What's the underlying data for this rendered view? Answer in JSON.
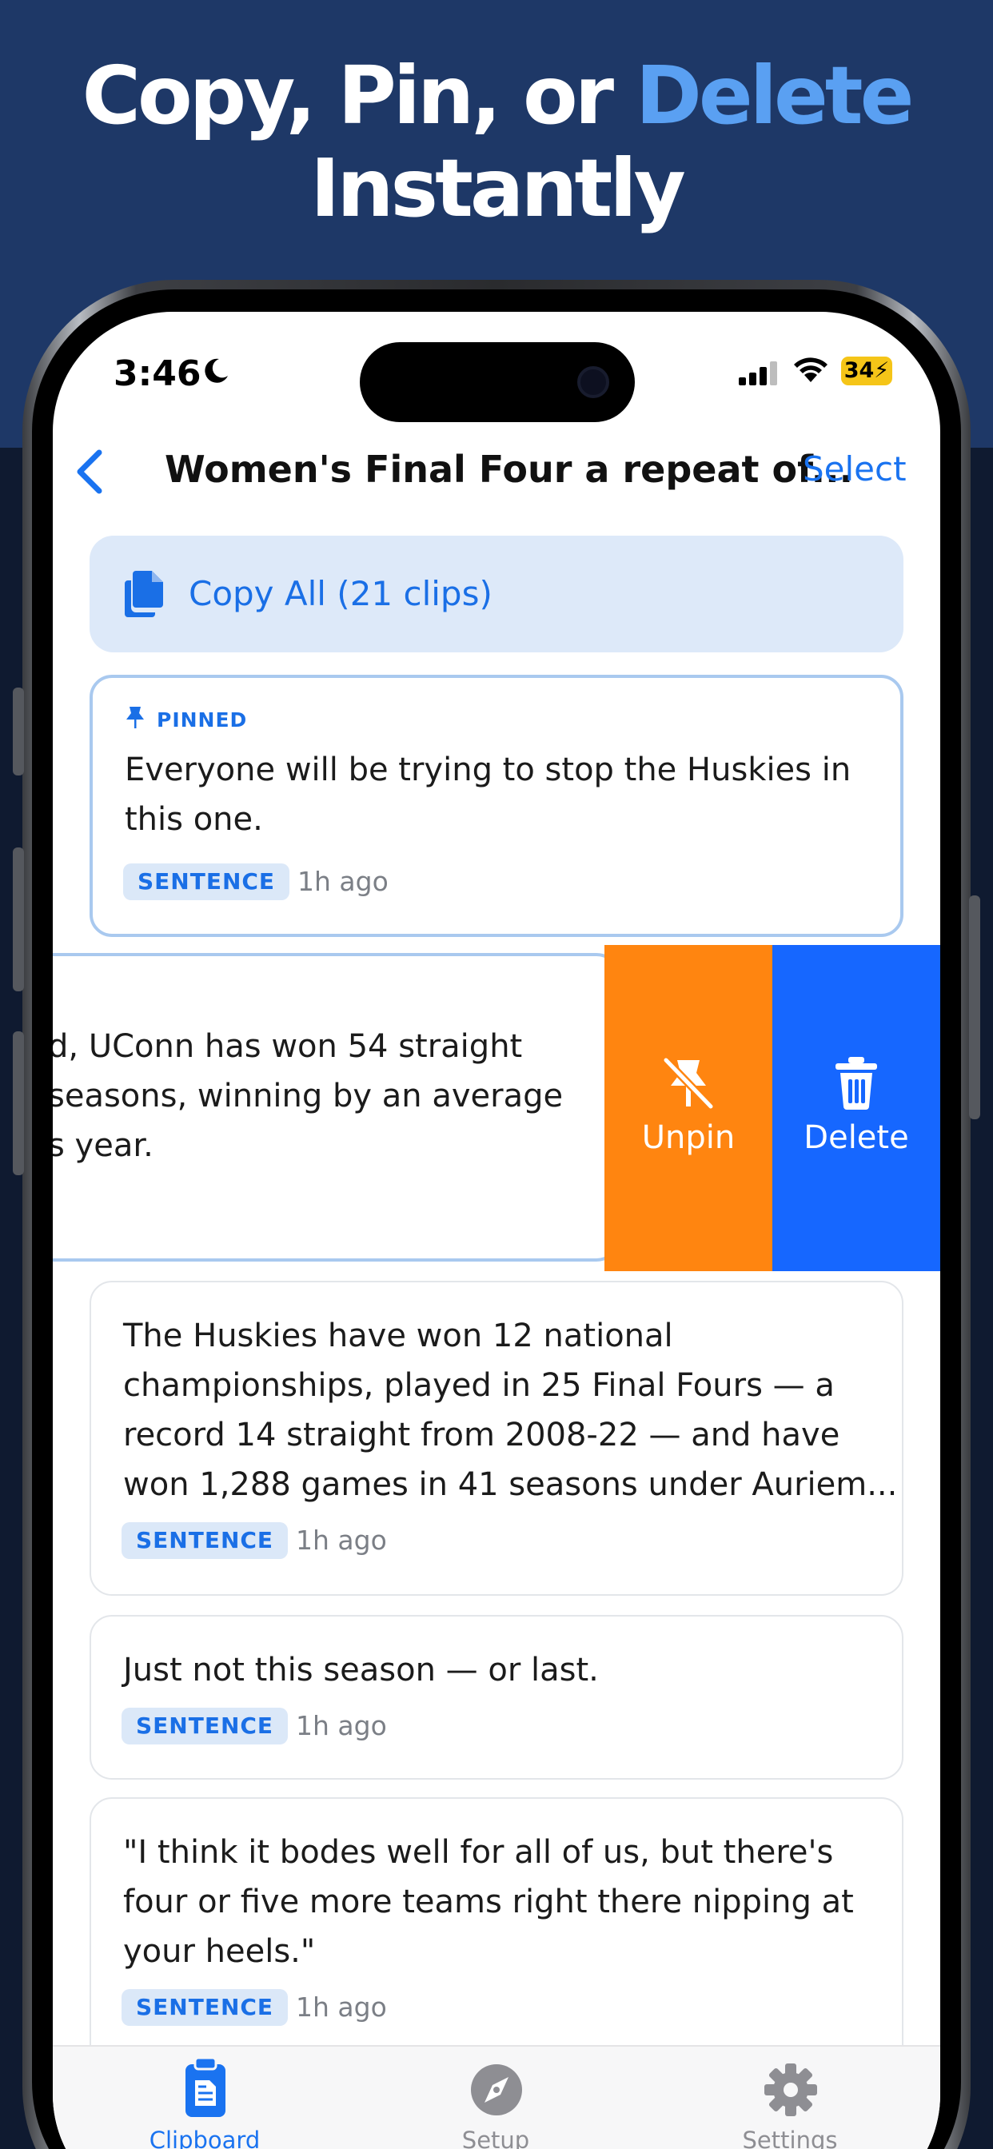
{
  "headline": {
    "line1_part1": "Copy, Pin, or ",
    "line1_accent": "Delete",
    "line2": "Instantly"
  },
  "colors": {
    "accent": "#5aa0f2",
    "primary_blue": "#1a73f0",
    "unpin_orange": "#ff8510",
    "delete_blue": "#1667ff"
  },
  "status_bar": {
    "time": "3:46",
    "battery": "34"
  },
  "nav": {
    "title": "Women's Final Four a repeat of...",
    "select_label": "Select"
  },
  "copy_all": {
    "label": "Copy All (21 clips)"
  },
  "clips": [
    {
      "pinned_label": "PINNED",
      "lines": [
        "Everyone will be trying to stop the Huskies in",
        "this one."
      ],
      "type": "SENTENCE",
      "time": "1h ago"
    },
    {
      "lines": [
        "d, UConn has won 54 straight",
        "seasons, winning by an average",
        "s year."
      ]
    },
    {
      "lines": [
        "The Huskies have won 12 national",
        "championships, played in 25 Final Fours — a",
        "record 14 straight from 2008-22 — and have",
        "won 1,288 games in 41 seasons under Auriem..."
      ],
      "type": "SENTENCE",
      "time": "1h ago"
    },
    {
      "lines": [
        "Just not this season — or last."
      ],
      "type": "SENTENCE",
      "time": "1h ago"
    },
    {
      "lines": [
        "\"I think it bodes well for all of us, but there's",
        "four or five more teams right there nipping at",
        "your heels.\""
      ],
      "type": "SENTENCE",
      "time": "1h ago"
    }
  ],
  "swipe_actions": {
    "unpin_label": "Unpin",
    "delete_label": "Delete"
  },
  "tabs": [
    {
      "label": "Clipboard",
      "icon": "clipboard-icon",
      "active": true
    },
    {
      "label": "Setup",
      "icon": "compass-icon",
      "active": false
    },
    {
      "label": "Settings",
      "icon": "gear-icon",
      "active": false
    }
  ]
}
